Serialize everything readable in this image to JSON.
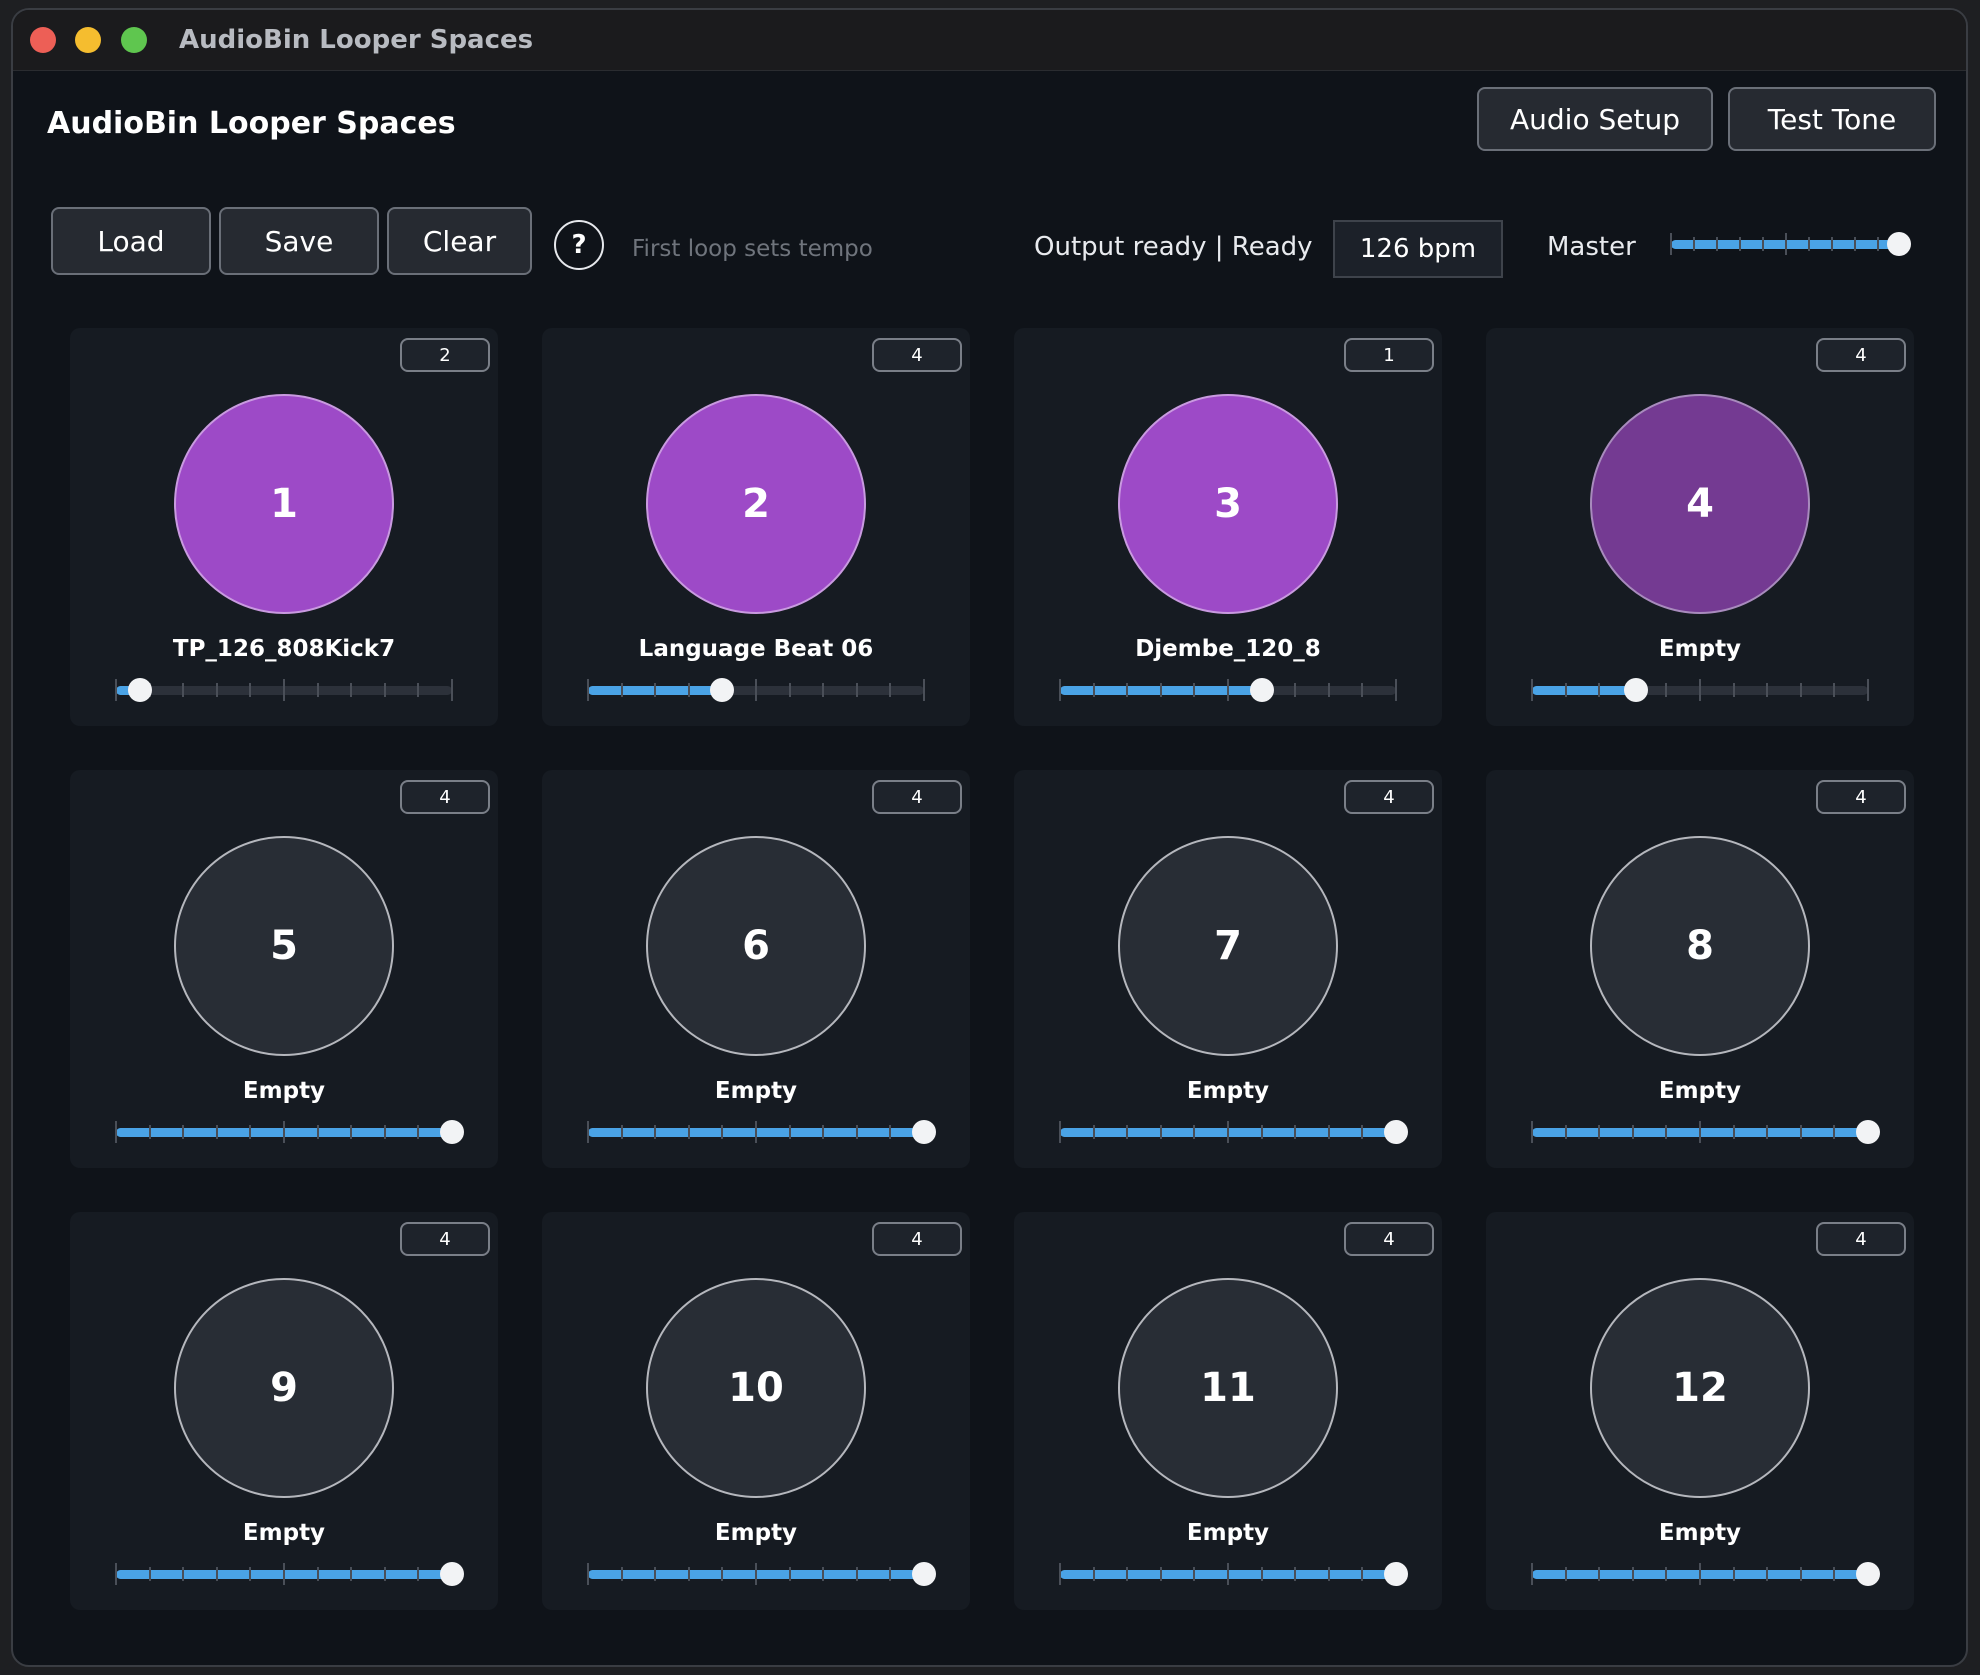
{
  "window": {
    "title": "AudioBin Looper Spaces"
  },
  "header": {
    "title": "AudioBin Looper Spaces",
    "audio_setup_label": "Audio Setup",
    "test_tone_label": "Test Tone"
  },
  "toolbar": {
    "load_label": "Load",
    "save_label": "Save",
    "clear_label": "Clear",
    "help_label": "?",
    "hint": "First loop sets tempo",
    "status": "Output ready | Ready",
    "bpm": "126 bpm",
    "master_label": "Master",
    "master_level": 0.99
  },
  "colors": {
    "loaded_pad": "#9d4ac7",
    "pending_pad": "#743a92",
    "empty_pad": "#282d35",
    "slider_fill": "#4aa3e6"
  },
  "pads": [
    {
      "number": "1",
      "name": "TP_126_808Kick7",
      "badge": "2",
      "state": "loaded",
      "volume": 0.07
    },
    {
      "number": "2",
      "name": "Language Beat 06",
      "badge": "4",
      "state": "loaded",
      "volume": 0.4
    },
    {
      "number": "3",
      "name": "Djembe_120_8",
      "badge": "1",
      "state": "loaded",
      "volume": 0.6
    },
    {
      "number": "4",
      "name": "Empty",
      "badge": "4",
      "state": "dim",
      "volume": 0.31
    },
    {
      "number": "5",
      "name": "Empty",
      "badge": "4",
      "state": "empty",
      "volume": 1.0
    },
    {
      "number": "6",
      "name": "Empty",
      "badge": "4",
      "state": "empty",
      "volume": 1.0
    },
    {
      "number": "7",
      "name": "Empty",
      "badge": "4",
      "state": "empty",
      "volume": 1.0
    },
    {
      "number": "8",
      "name": "Empty",
      "badge": "4",
      "state": "empty",
      "volume": 1.0
    },
    {
      "number": "9",
      "name": "Empty",
      "badge": "4",
      "state": "empty",
      "volume": 1.0
    },
    {
      "number": "10",
      "name": "Empty",
      "badge": "4",
      "state": "empty",
      "volume": 1.0
    },
    {
      "number": "11",
      "name": "Empty",
      "badge": "4",
      "state": "empty",
      "volume": 1.0
    },
    {
      "number": "12",
      "name": "Empty",
      "badge": "4",
      "state": "empty",
      "volume": 1.0
    }
  ]
}
